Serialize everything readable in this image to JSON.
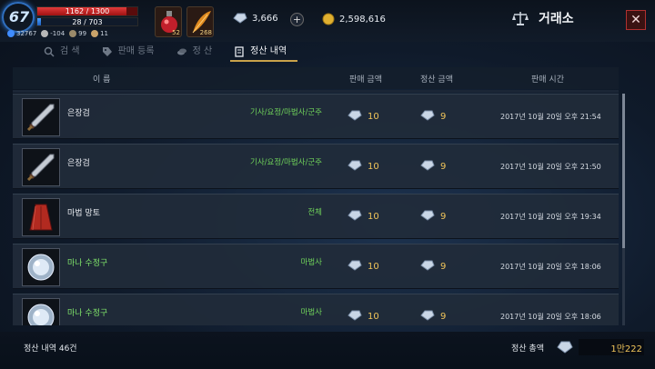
{
  "player": {
    "level": "67",
    "hp": "1162 / 1300",
    "hp_fraction": 0.894,
    "mp": "28 / 703",
    "mp_fraction": 0.04,
    "stats": [
      "32767",
      "-104",
      "99",
      "11"
    ]
  },
  "potions": [
    {
      "icon": "red-potion-icon",
      "count": "52"
    },
    {
      "icon": "feather-icon",
      "count": "268"
    }
  ],
  "currency": {
    "diamonds": "3,666",
    "gold": "2,598,616"
  },
  "window": {
    "title": "거래소",
    "icon": "scales-icon",
    "close_label": "✕"
  },
  "tabs": [
    {
      "label": "검 색",
      "icon": "search-icon",
      "active": false
    },
    {
      "label": "판매 등록",
      "icon": "tag-icon",
      "active": false
    },
    {
      "label": "정 산",
      "icon": "coins-icon",
      "active": false
    },
    {
      "label": "정산 내역",
      "icon": "document-icon",
      "active": true
    }
  ],
  "columns": {
    "name": "이 름",
    "sale_amount": "판매 금액",
    "settle_amount": "정산 금액",
    "sale_time": "판매 시간"
  },
  "rows": [
    {
      "icon": "sword-icon",
      "name": "은장검",
      "name_color": "white",
      "classes": "기사/요정/마법사/군주",
      "sale": "10",
      "settle": "9",
      "time": "2017년 10월 20일 오후 21:54"
    },
    {
      "icon": "sword-icon",
      "name": "은장검",
      "name_color": "white",
      "classes": "기사/요정/마법사/군주",
      "sale": "10",
      "settle": "9",
      "time": "2017년 10월 20일 오후 21:50"
    },
    {
      "icon": "cloak-icon",
      "name": "마법 망토",
      "name_color": "white",
      "classes": "전체",
      "sale": "10",
      "settle": "9",
      "time": "2017년 10월 20일 오후 19:34"
    },
    {
      "icon": "crystal-icon",
      "name": "마나 수정구",
      "name_color": "green",
      "classes": "마법사",
      "sale": "10",
      "settle": "9",
      "time": "2017년 10월 20일 오후 18:06"
    },
    {
      "icon": "crystal-icon",
      "name": "마나 수정구",
      "name_color": "green",
      "classes": "마법사",
      "sale": "10",
      "settle": "9",
      "time": "2017년 10월 20일 오후 18:06"
    }
  ],
  "footer": {
    "history_count": "정산 내역 46건",
    "total_label": "정산 총액",
    "total_value": "1만222"
  },
  "colors": {
    "accent_gold": "#f1c55a",
    "class_green": "#6fd15a",
    "close_red": "#b03030"
  }
}
